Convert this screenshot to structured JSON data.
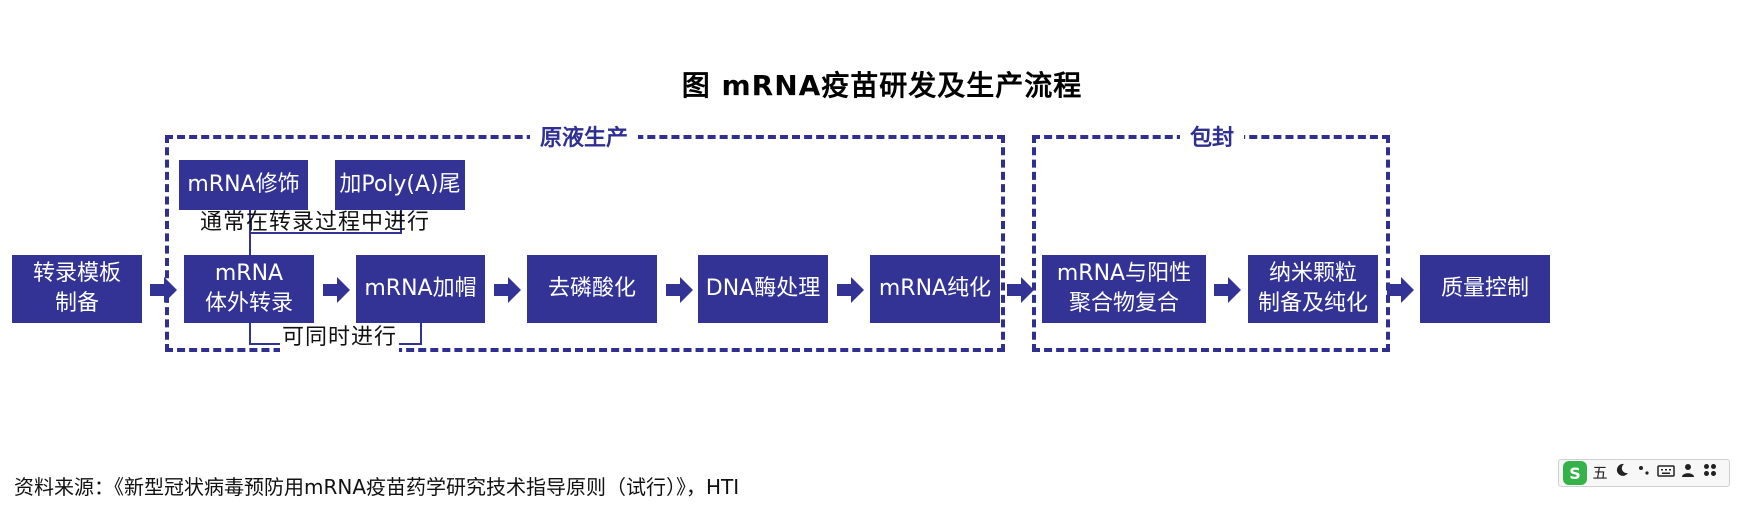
{
  "title": "图  mRNA疫苗研发及生产流程",
  "groups": {
    "drug_substance": "原液生产",
    "packaging": "包封"
  },
  "modifiers": {
    "mrna_modification": "mRNA修饰",
    "poly_a_tail": "加Poly(A)尾"
  },
  "notes": {
    "during_transcription": "通常在转录过程中进行",
    "simultaneous": "可同时进行"
  },
  "steps": [
    "转录模板\n制备",
    "mRNA\n体外转录",
    "mRNA加帽",
    "去磷酸化",
    "DNA酶处理",
    "mRNA纯化",
    "mRNA与阳性\n聚合物复合",
    "纳米颗粒\n制备及纯化",
    "质量控制"
  ],
  "source": "资料来源：《新型冠状病毒预防用mRNA疫苗药学研究技术指导原则（试行）》，HTI",
  "colors": {
    "box_fill": "#333396",
    "dashed_border": "#2f2f92",
    "text_on_box": "#ffffff"
  },
  "ime_toolbar": {
    "logo": "S",
    "mode": "五",
    "icons": [
      "moon-icon",
      "punctuation-icon",
      "keyboard-icon",
      "user-icon",
      "grid-icon"
    ]
  }
}
